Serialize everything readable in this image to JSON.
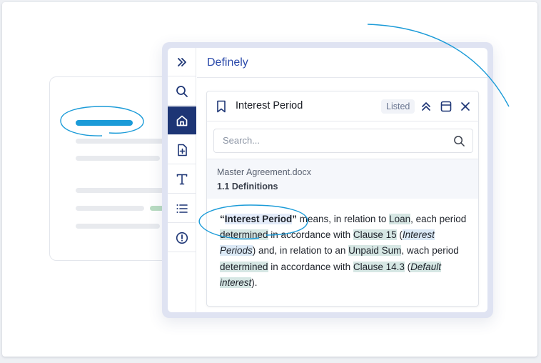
{
  "app": {
    "title": "Definely"
  },
  "rail": {
    "items": [
      {
        "id": "expand",
        "icon": "double-chevron-right-icon"
      },
      {
        "id": "search",
        "icon": "search-icon"
      },
      {
        "id": "home",
        "icon": "home-icon",
        "active": true
      },
      {
        "id": "new-doc",
        "icon": "file-plus-icon"
      },
      {
        "id": "text",
        "icon": "text-t-icon"
      },
      {
        "id": "list",
        "icon": "list-icon"
      },
      {
        "id": "alert",
        "icon": "alert-circle-icon"
      }
    ]
  },
  "card": {
    "title": "Interest Period",
    "badge": "Listed",
    "search": {
      "placeholder": "Search...",
      "value": ""
    },
    "source": {
      "file": "Master Agreement.docx",
      "section": "1.1 Definitions"
    },
    "definition": {
      "open_quote": "“",
      "term": "Interest Period",
      "close_quote": "”",
      "t1": " means, in relation to ",
      "link_loan": "Loan",
      "t2": ", each period ",
      "link_determined_1": "determined",
      "t3": " in accordance with ",
      "link_clause15": "Clause 15",
      "t4": " (",
      "ref_interest_periods": "Interest Periods",
      "t5": ") and, in relation to an ",
      "link_unpaid_sum": "Unpaid Sum",
      "t6": ", wach period ",
      "link_determined_2": "determined",
      "t7": " in accordance with ",
      "link_clause143": "Clause 14.3",
      "t8": " (",
      "ref_default_interest": "Default interest",
      "t9": ")."
    }
  },
  "colors": {
    "brand": "#2c4bab",
    "rail_active": "#1d3575",
    "highlight_green": "#d6e7e4",
    "highlight_blue": "#dbe9f6",
    "annotation_stroke": "#1b9bd8"
  }
}
